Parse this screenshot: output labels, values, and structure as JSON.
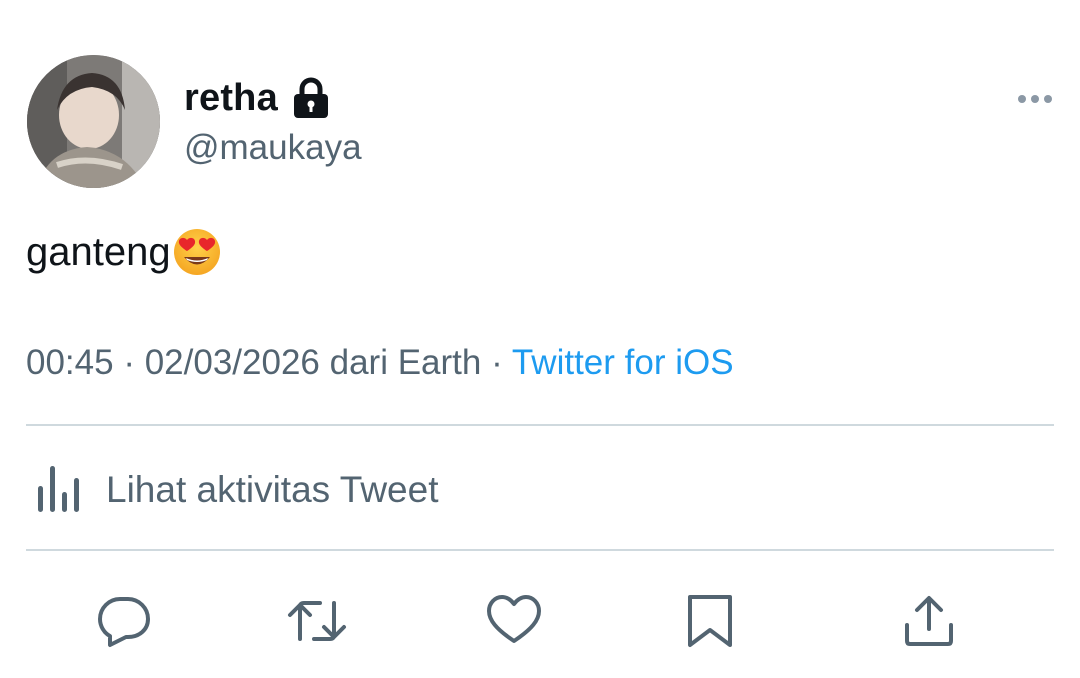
{
  "author": {
    "display_name": "retha",
    "handle": "@maukaya",
    "protected_icon": "lock-icon",
    "avatar": "profile-photo"
  },
  "tweet": {
    "text": "ganteng",
    "emoji": "heart-eyes-emoji"
  },
  "meta": {
    "time": "00:45",
    "separator1": "·",
    "date": "02/03/2026",
    "location": "dari Earth",
    "separator2": "·",
    "source": "Twitter for iOS"
  },
  "activity": {
    "label": "Lihat aktivitas Tweet",
    "icon": "analytics-icon"
  },
  "actions": [
    {
      "icon": "reply-icon"
    },
    {
      "icon": "retweet-icon"
    },
    {
      "icon": "like-icon"
    },
    {
      "icon": "bookmark-icon"
    },
    {
      "icon": "share-icon"
    }
  ],
  "colors": {
    "text": "#0f1419",
    "secondary": "#536471",
    "link": "#1d9bf0",
    "divider": "#cfd9de"
  }
}
